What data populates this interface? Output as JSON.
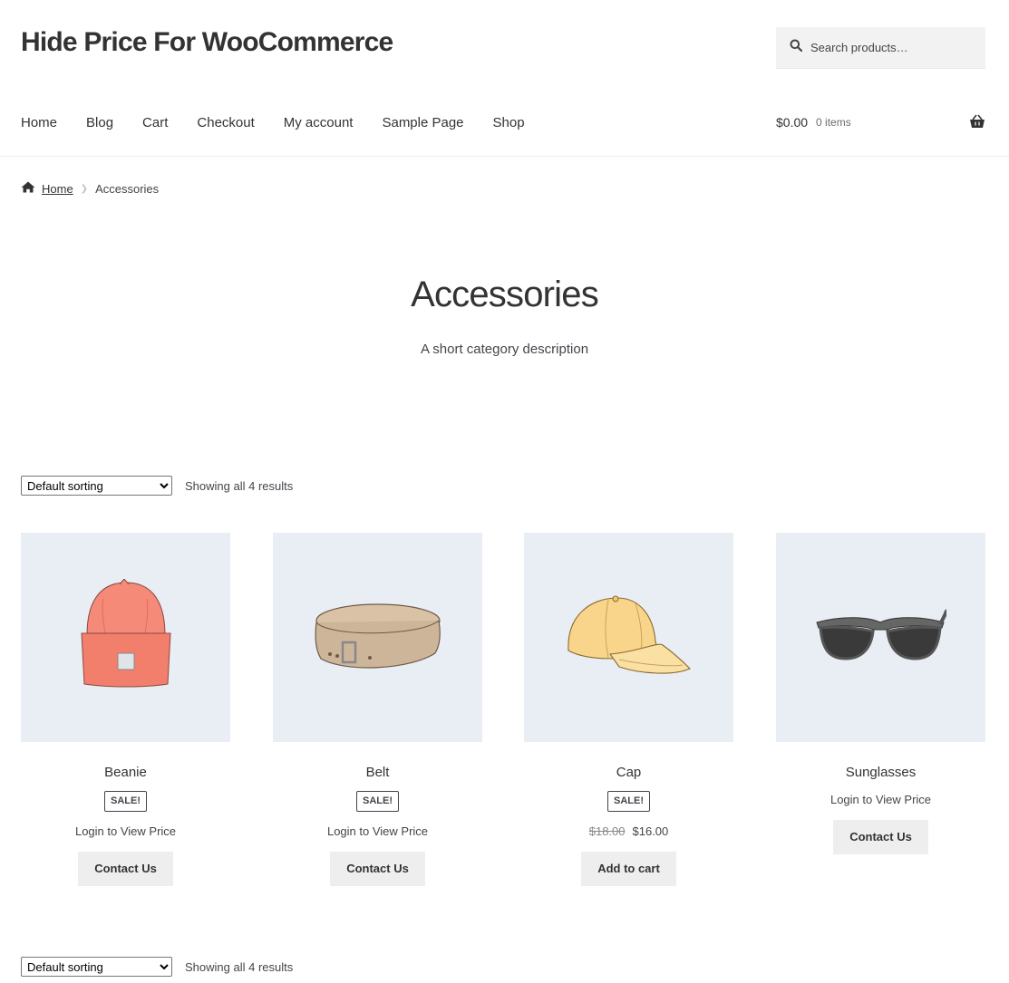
{
  "site": {
    "title": "Hide Price For WooCommerce"
  },
  "search": {
    "placeholder": "Search products…"
  },
  "nav": {
    "items": [
      {
        "label": "Home"
      },
      {
        "label": "Blog"
      },
      {
        "label": "Cart"
      },
      {
        "label": "Checkout"
      },
      {
        "label": "My account"
      },
      {
        "label": "Sample Page"
      },
      {
        "label": "Shop"
      }
    ]
  },
  "cart": {
    "amount": "$0.00",
    "items": "0 items"
  },
  "breadcrumb": {
    "home": "Home",
    "current": "Accessories"
  },
  "page": {
    "title": "Accessories",
    "description": "A short category description"
  },
  "toolbar": {
    "sort_selected": "Default sorting",
    "result_count": "Showing all 4 results"
  },
  "products": [
    {
      "name": "Beanie",
      "badge": "SALE!",
      "price_text": "Login to View Price",
      "button": "Contact Us",
      "icon": "beanie-image"
    },
    {
      "name": "Belt",
      "badge": "SALE!",
      "price_text": "Login to View Price",
      "button": "Contact Us",
      "icon": "belt-image"
    },
    {
      "name": "Cap",
      "badge": "SALE!",
      "price_old": "$18.00",
      "price_new": "$16.00",
      "button": "Add to cart",
      "icon": "cap-image"
    },
    {
      "name": "Sunglasses",
      "price_text": "Login to View Price",
      "button": "Contact Us",
      "icon": "sunglasses-image"
    }
  ],
  "colors": {
    "accent": "#333333",
    "button_bg": "#eeeeee",
    "thumb_bg": "#e9eef4",
    "beanie": "#f58a78",
    "belt": "#cdb59a",
    "cap": "#f9d58b",
    "sunglasses": "#555555"
  }
}
